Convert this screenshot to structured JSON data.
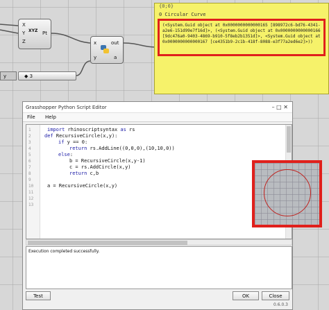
{
  "canvas": {
    "pt_component": {
      "inputs": [
        "X",
        "Y",
        "Z"
      ],
      "output": "Pt",
      "icon_label": "XYZ"
    },
    "python_component": {
      "inputs": [
        "x",
        "y"
      ],
      "outputs": [
        "out",
        "a"
      ]
    },
    "slider": {
      "name": "y",
      "value": "◆ 3"
    },
    "panel": {
      "header": "{0;0}",
      "title": "0 Circular Curve",
      "output": "(<System.Guid object at 0x0000000000000165 [898972c6-bd76-4341-a2e6-151d99e7f16d]>, (<System.Guid object at 0x0000000000000166 [9dc476a0-9403-4869-b910-5f8eb2b1351d]>, <System.Guid object at 0x0000000000000167 [ce4351b9-2c1b-418f-8088-e3f77a2ed6e2]>))"
    }
  },
  "editor": {
    "title": "Grasshopper Python Script Editor",
    "window_controls": "– □ ✕",
    "menu": [
      "File",
      "Help"
    ],
    "line_numbers": [
      "1",
      "2",
      "3",
      "4",
      "5",
      "6",
      "7",
      "8",
      "9",
      "10",
      "11",
      "12",
      "13"
    ],
    "code": {
      "l1a": "import",
      "l1b": " rhinoscriptsyntax ",
      "l1c": "as",
      "l1d": " rs",
      "l2a": "def",
      "l2b": " RecursiveCircle(x,y):",
      "l3a": "if",
      "l3b": " y == 0:",
      "l4a": "return",
      "l4b": " rs.AddLine((0,0,0),(10,10,0))",
      "l5a": "else",
      "l5b": ":",
      "l6": "b = RecursiveCircle(x,y-1)",
      "l7": "c = rs.AddCircle(x,y)",
      "l8a": "return",
      "l8b": " c,b",
      "l10": "a = RecursiveCircle(x,y)"
    },
    "output_text": "Execution completed successfully.",
    "buttons": {
      "test": "Test",
      "ok": "OK",
      "close": "Close"
    },
    "version": "0.6.0.3"
  }
}
